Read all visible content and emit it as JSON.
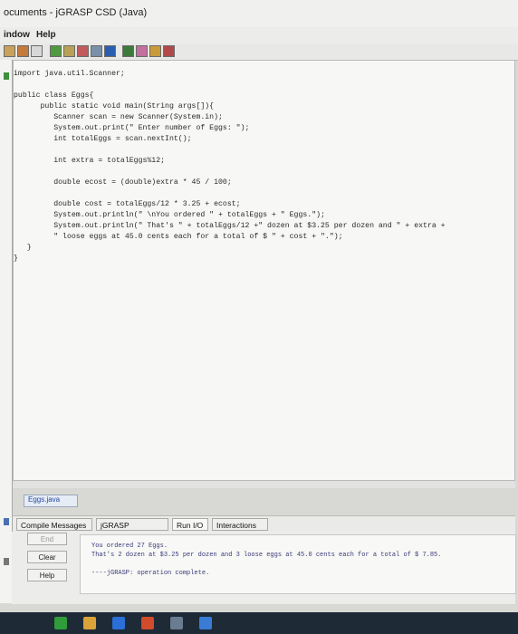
{
  "window": {
    "title": "ocuments - jGRASP CSD (Java)"
  },
  "menu": {
    "items": [
      "indow",
      "Help"
    ]
  },
  "code_lines": [
    "import java.util.Scanner;",
    "",
    "public class Eggs{",
    "      public static void main(String args[]){",
    "         Scanner scan = new Scanner(System.in);",
    "         System.out.print(\" Enter number of Eggs: \");",
    "         int totalEggs = scan.nextInt();",
    "",
    "         int extra = totalEggs%12;",
    "",
    "         double ecost = (double)extra * 45 / 100;",
    "",
    "         double cost = totalEggs/12 * 3.25 + ecost;",
    "         System.out.println(\" \\nYou ordered \" + totalEggs + \" Eggs.\");",
    "         System.out.println(\" That's \" + totalEggs/12 +\" dozen at $3.25 per dozen and \" + extra +",
    "         \" loose eggs at 45.0 cents each for a total of $ \" + cost + \".\");",
    "   }",
    "}"
  ],
  "file_tab": {
    "label": "Eggs.java"
  },
  "bottom_tabs": [
    "Compile Messages",
    "jGRASP Messages",
    "Run I/O",
    "Interactions"
  ],
  "buttons": {
    "end": "End",
    "clear": "Clear",
    "help": "Help"
  },
  "output_lines": [
    "You ordered 27 Eggs.",
    "That's 2 dozen at $3.25 per dozen and 3 loose eggs at 45.0 cents each for a total of $ 7.85.",
    "",
    "----jGRASP: operation complete."
  ],
  "colors": {
    "keyword": "#9b3a6a",
    "string": "#5b7a2f",
    "output": "#3a3a7a"
  }
}
